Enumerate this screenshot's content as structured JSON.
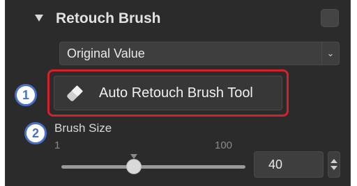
{
  "section": {
    "title": "Retouch Brush",
    "enabled": false
  },
  "dropdown": {
    "value": "Original Value",
    "arrow": "⌄"
  },
  "tool": {
    "label": "Auto Retouch Brush Tool",
    "icon": "eraser-icon",
    "highlight_color": "#d2232a"
  },
  "callouts": [
    "1",
    "2"
  ],
  "brush_size": {
    "label": "Brush Size",
    "min": "1",
    "max": "100",
    "value": "40",
    "level": 40
  },
  "colors": {
    "panel_bg": "#2b2b2b",
    "callout_blue": "#4a70c9"
  }
}
